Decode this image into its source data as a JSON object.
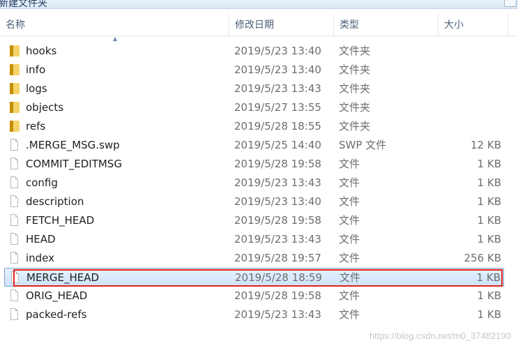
{
  "window": {
    "title_fragment": "新建文件夹"
  },
  "columns": {
    "name": "名称",
    "date": "修改日期",
    "type": "类型",
    "size": "大小"
  },
  "rows": [
    {
      "kind": "folder",
      "name": "hooks",
      "date": "2019/5/23 13:40",
      "type": "文件夹",
      "size": ""
    },
    {
      "kind": "folder",
      "name": "info",
      "date": "2019/5/23 13:40",
      "type": "文件夹",
      "size": ""
    },
    {
      "kind": "folder",
      "name": "logs",
      "date": "2019/5/23 13:43",
      "type": "文件夹",
      "size": ""
    },
    {
      "kind": "folder",
      "name": "objects",
      "date": "2019/5/27 13:55",
      "type": "文件夹",
      "size": ""
    },
    {
      "kind": "folder",
      "name": "refs",
      "date": "2019/5/28 18:55",
      "type": "文件夹",
      "size": ""
    },
    {
      "kind": "file",
      "name": ".MERGE_MSG.swp",
      "date": "2019/5/25 14:40",
      "type": "SWP 文件",
      "size": "12 KB"
    },
    {
      "kind": "file",
      "name": "COMMIT_EDITMSG",
      "date": "2019/5/28 19:58",
      "type": "文件",
      "size": "1 KB"
    },
    {
      "kind": "file",
      "name": "config",
      "date": "2019/5/23 13:43",
      "type": "文件",
      "size": "1 KB"
    },
    {
      "kind": "file",
      "name": "description",
      "date": "2019/5/23 13:40",
      "type": "文件",
      "size": "1 KB"
    },
    {
      "kind": "file",
      "name": "FETCH_HEAD",
      "date": "2019/5/28 19:58",
      "type": "文件",
      "size": "1 KB"
    },
    {
      "kind": "file",
      "name": "HEAD",
      "date": "2019/5/23 13:43",
      "type": "文件",
      "size": "1 KB"
    },
    {
      "kind": "file",
      "name": "index",
      "date": "2019/5/28 19:57",
      "type": "文件",
      "size": "256 KB"
    },
    {
      "kind": "file",
      "name": "MERGE_HEAD",
      "date": "2019/5/28 18:59",
      "type": "文件",
      "size": "1 KB",
      "selected": true
    },
    {
      "kind": "file",
      "name": "ORIG_HEAD",
      "date": "2019/5/28 19:58",
      "type": "文件",
      "size": "1 KB"
    },
    {
      "kind": "file",
      "name": "packed-refs",
      "date": "2019/5/23 13:43",
      "type": "文件",
      "size": "1 KB"
    }
  ],
  "watermark": "https://blog.csdn.net/m0_37482190"
}
